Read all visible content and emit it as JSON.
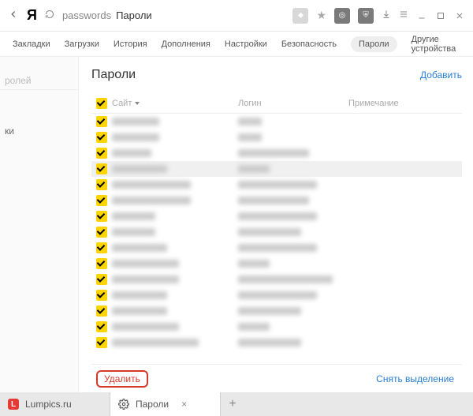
{
  "toolbar": {
    "logo": "Я",
    "address_path": "passwords",
    "address_title": "Пароли"
  },
  "tabs": {
    "items": [
      {
        "label": "Закладки"
      },
      {
        "label": "Загрузки"
      },
      {
        "label": "История"
      },
      {
        "label": "Дополнения"
      },
      {
        "label": "Настройки"
      },
      {
        "label": "Безопасность"
      },
      {
        "label": "Пароли",
        "active": true
      },
      {
        "label": "Другие устройства"
      }
    ]
  },
  "sidebar": {
    "search_placeholder": "ролей",
    "item1": "ки"
  },
  "content": {
    "title": "Пароли",
    "add_label": "Добавить",
    "columns": {
      "site": "Сайт",
      "login": "Логин",
      "note": "Примечание"
    },
    "rows": [
      {
        "checked": true,
        "site_w": 60,
        "login_w": 30,
        "highlight": false
      },
      {
        "checked": true,
        "site_w": 60,
        "login_w": 30,
        "highlight": false
      },
      {
        "checked": true,
        "site_w": 50,
        "login_w": 90,
        "highlight": false
      },
      {
        "checked": true,
        "site_w": 70,
        "login_w": 40,
        "highlight": true
      },
      {
        "checked": true,
        "site_w": 100,
        "login_w": 100,
        "highlight": false
      },
      {
        "checked": true,
        "site_w": 100,
        "login_w": 90,
        "highlight": false
      },
      {
        "checked": true,
        "site_w": 55,
        "login_w": 100,
        "highlight": false
      },
      {
        "checked": true,
        "site_w": 55,
        "login_w": 80,
        "highlight": false
      },
      {
        "checked": true,
        "site_w": 70,
        "login_w": 100,
        "highlight": false
      },
      {
        "checked": true,
        "site_w": 85,
        "login_w": 40,
        "highlight": false
      },
      {
        "checked": true,
        "site_w": 85,
        "login_w": 120,
        "highlight": false
      },
      {
        "checked": true,
        "site_w": 70,
        "login_w": 100,
        "highlight": false
      },
      {
        "checked": true,
        "site_w": 70,
        "login_w": 80,
        "highlight": false
      },
      {
        "checked": true,
        "site_w": 85,
        "login_w": 40,
        "highlight": false
      },
      {
        "checked": true,
        "site_w": 110,
        "login_w": 80,
        "highlight": false
      }
    ],
    "delete_label": "Удалить",
    "deselect_label": "Снять выделение"
  },
  "browser_tabs": {
    "tab1": {
      "label": "Lumpics.ru",
      "favicon": "L"
    },
    "tab2": {
      "label": "Пароли"
    }
  }
}
